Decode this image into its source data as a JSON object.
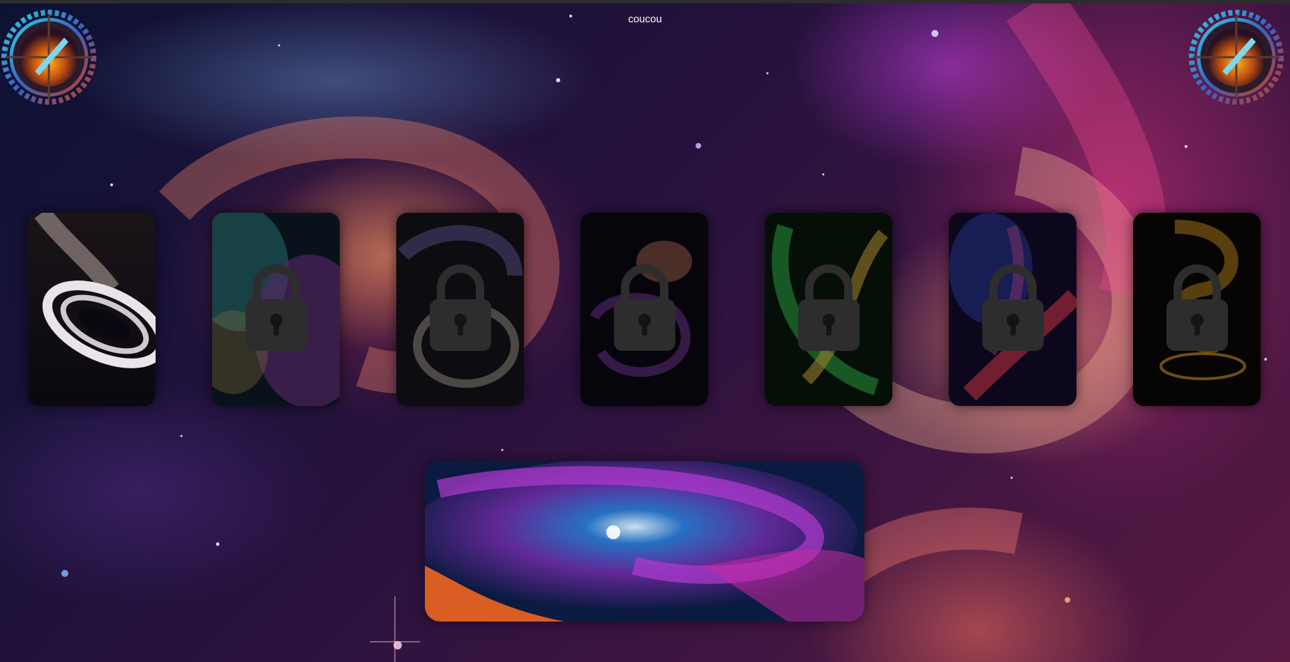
{
  "page": {
    "title": "coucou"
  },
  "emblems": [
    {
      "id": "left",
      "icon": "compass-gear-emblem-icon"
    },
    {
      "id": "right",
      "icon": "compass-gear-emblem-icon"
    }
  ],
  "cards": [
    {
      "index": 1,
      "theme": "white-ringed-black-hole",
      "locked": false,
      "colors": [
        "#0a0810",
        "#e8e4ea"
      ]
    },
    {
      "index": 2,
      "theme": "teal-purple-nebula",
      "locked": true,
      "colors": [
        "#0e1c28",
        "#3aa0a0",
        "#8a3aa0"
      ]
    },
    {
      "index": 3,
      "theme": "grey-swirl-galaxy",
      "locked": true,
      "colors": [
        "#141218",
        "#a8a096",
        "#6a5aa0"
      ]
    },
    {
      "index": 4,
      "theme": "dark-violet-vortex",
      "locked": true,
      "colors": [
        "#0a0810",
        "#7a3aa0",
        "#e08a6a"
      ]
    },
    {
      "index": 5,
      "theme": "green-gold-vortex",
      "locked": true,
      "colors": [
        "#08140a",
        "#2aa040",
        "#e0b040"
      ]
    },
    {
      "index": 6,
      "theme": "red-blue-nebula",
      "locked": true,
      "colors": [
        "#120a28",
        "#2a3aa0",
        "#e03a50"
      ]
    },
    {
      "index": 7,
      "theme": "golden-swirl",
      "locked": true,
      "colors": [
        "#0a0806",
        "#e0a020",
        "#b06a10"
      ]
    }
  ],
  "lock": {
    "icon": "padlock-icon",
    "color": "#2d2d2d"
  },
  "banner": {
    "theme": "blue-purple-spiral-galaxy",
    "colors": [
      "#0b1a40",
      "#2a7ad0",
      "#b03ad0",
      "#ff6a20"
    ]
  }
}
